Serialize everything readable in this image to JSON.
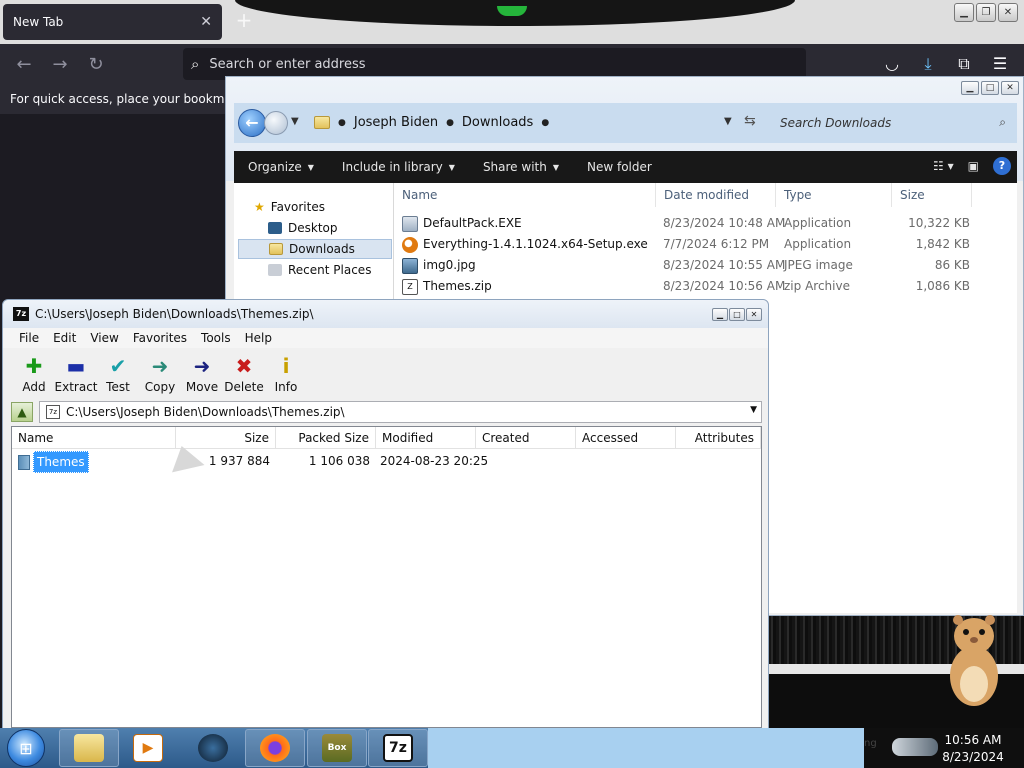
{
  "browser": {
    "tab_title": "New Tab",
    "url_placeholder": "Search or enter address",
    "bookmarks_hint": "For quick access, place your bookmarks here on the bookmarks toolbar."
  },
  "explorer": {
    "breadcrumb": [
      "Joseph Biden",
      "Downloads"
    ],
    "search_placeholder": "Search Downloads",
    "commands": [
      "Organize",
      "Include in library",
      "Share with",
      "New folder"
    ],
    "nav": {
      "favorites_label": "Favorites",
      "items": [
        "Desktop",
        "Downloads",
        "Recent Places"
      ]
    },
    "columns": [
      "Name",
      "Date modified",
      "Type",
      "Size"
    ],
    "files": [
      {
        "name": "DefaultPack.EXE",
        "date": "8/23/2024 10:48 AM",
        "type": "Application",
        "size": "10,322 KB",
        "icon": "exe-icon"
      },
      {
        "name": "Everything-1.4.1.1024.x64-Setup.exe",
        "date": "7/7/2024 6:12 PM",
        "type": "Application",
        "size": "1,842 KB",
        "icon": "search-app-icon"
      },
      {
        "name": "img0.jpg",
        "date": "8/23/2024 10:55 AM",
        "type": "JPEG image",
        "size": "86 KB",
        "icon": "image-icon"
      },
      {
        "name": "Themes.zip",
        "date": "8/23/2024 10:56 AM",
        "type": "zip Archive",
        "size": "1,086 KB",
        "icon": "zip-icon"
      }
    ]
  },
  "zip": {
    "title": "C:\\Users\\Joseph Biden\\Downloads\\Themes.zip\\",
    "menu": [
      "File",
      "Edit",
      "View",
      "Favorites",
      "Tools",
      "Help"
    ],
    "tools": [
      {
        "label": "Add",
        "glyph": "✚",
        "color": "#1a9a1a"
      },
      {
        "label": "Extract",
        "glyph": "▬",
        "color": "#1c2fa8"
      },
      {
        "label": "Test",
        "glyph": "✔",
        "color": "#19a0a8"
      },
      {
        "label": "Copy",
        "glyph": "➜",
        "color": "#2a8a78"
      },
      {
        "label": "Move",
        "glyph": "➜",
        "color": "#1c2380"
      },
      {
        "label": "Delete",
        "glyph": "✖",
        "color": "#c81b1b"
      },
      {
        "label": "Info",
        "glyph": "i",
        "color": "#c8a000"
      }
    ],
    "path": "C:\\Users\\Joseph Biden\\Downloads\\Themes.zip\\",
    "columns": [
      "Name",
      "Size",
      "Packed Size",
      "Modified",
      "Created",
      "Accessed",
      "Attributes"
    ],
    "rows": [
      {
        "name": "Themes",
        "size": "1 937 884",
        "packed": "1 106 038",
        "modified": "2024-08-23 20:25",
        "created": "",
        "accessed": "",
        "attributes": ""
      }
    ]
  },
  "taskbar": {
    "tray_partial": "ng",
    "time": "10:56 AM",
    "date": "8/23/2024"
  }
}
